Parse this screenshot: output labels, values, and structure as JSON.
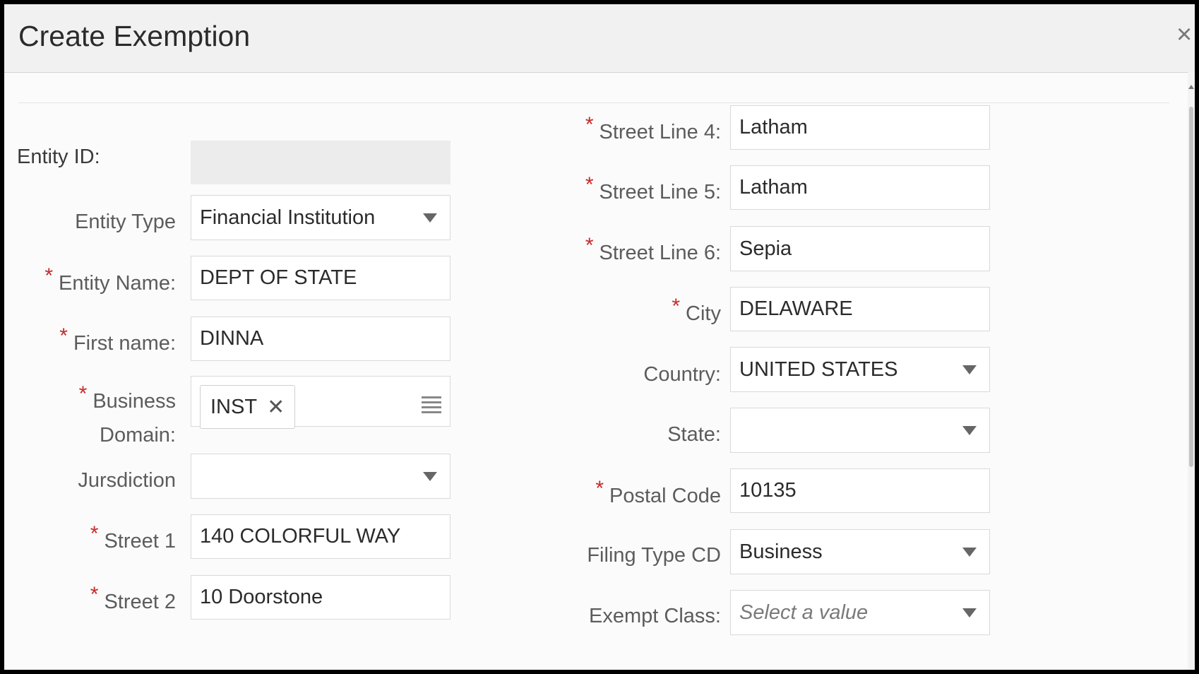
{
  "dialog": {
    "title": "Create Exemption",
    "close_label": "×"
  },
  "left": {
    "entity_id": {
      "label": "Entity ID:",
      "value": ""
    },
    "entity_type": {
      "label": "Entity Type",
      "value": "Financial Institution"
    },
    "entity_name": {
      "label": "Entity Name:",
      "value": "DEPT OF STATE"
    },
    "first_name": {
      "label": "First name:",
      "value": "DINNA"
    },
    "business_domain": {
      "label_line1": "Business",
      "label_line2": "Domain:",
      "chip": "INST",
      "chip_remove": "✕"
    },
    "jurisdiction": {
      "label": "Jursdiction",
      "value": ""
    },
    "street1": {
      "label": "Street 1",
      "value": "140 COLORFUL WAY"
    },
    "street2": {
      "label": "Street 2",
      "value": "10 Doorstone"
    }
  },
  "right": {
    "street4": {
      "label": "Street Line 4:",
      "value": "Latham"
    },
    "street5": {
      "label": "Street Line 5:",
      "value": "Latham"
    },
    "street6": {
      "label": "Street Line 6:",
      "value": "Sepia"
    },
    "city": {
      "label": "City",
      "value": "DELAWARE"
    },
    "country": {
      "label": "Country:",
      "value": "UNITED STATES"
    },
    "state": {
      "label": "State:",
      "value": ""
    },
    "postal_code": {
      "label": "Postal Code",
      "value": "10135"
    },
    "filing_type": {
      "label": "Filing Type CD",
      "value": "Business"
    },
    "exempt_class": {
      "label": "Exempt Class:",
      "placeholder": "Select a value"
    }
  },
  "required_marker": "*"
}
